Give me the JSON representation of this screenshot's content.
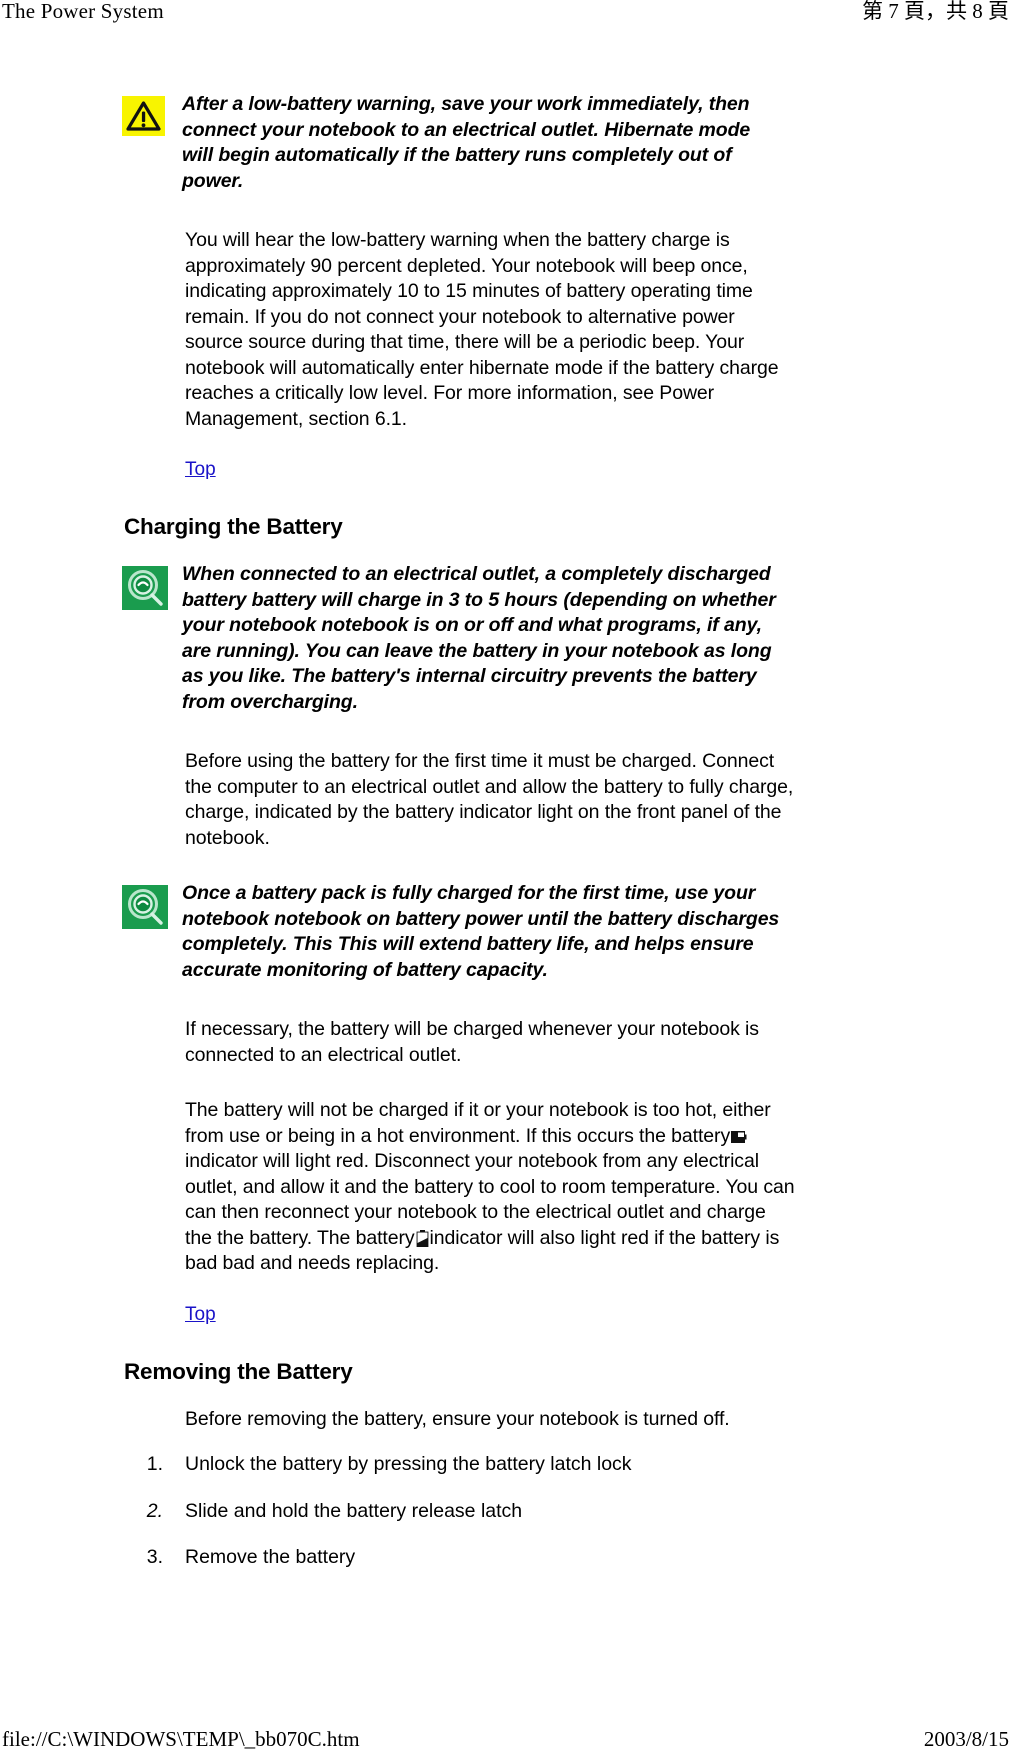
{
  "header": {
    "left_title": "The Power System",
    "right_pagination": "第 7 頁，共 8 頁"
  },
  "footer": {
    "left_path": "file://C:\\WINDOWS\\TEMP\\_bb070C.htm",
    "right_date": "2003/8/15"
  },
  "colors": {
    "warning_icon_bg": "#f8f400",
    "note_icon_bg": "#1a9c4e",
    "link": "#1a13c8",
    "text": "#000000",
    "page_bg": "#ffffff"
  },
  "content": {
    "warning_note": {
      "icon": "warning-triangle-icon",
      "text": "After a low-battery warning, save your work immediately, then connect your notebook to an electrical outlet. Hibernate mode will begin automatically if the battery runs completely out of power."
    },
    "para_low_battery": "You will hear the low-battery warning when the battery charge is approximately 90 percent depleted. Your notebook will beep once, indicating approximately 10 to 15 minutes of battery operating time remain. If you do not connect your notebook to alternative power source source during that time, there will be a periodic beep. Your notebook will automatically enter hibernate mode if the battery charge reaches a critically low level. For more information, see Power Management, section 6.1.",
    "top_link_1": "Top",
    "heading_charging": "Charging the Battery",
    "note_charging": {
      "icon": "magnifier-note-icon",
      "text": "When connected to an electrical outlet, a completely discharged battery battery will charge in 3 to 5 hours (depending on whether your notebook notebook is on or off and what programs, if any, are running). You can leave the battery in your notebook as long as you like. The battery's internal circuitry prevents the battery from overcharging."
    },
    "para_before_first_use": "Before using the battery for the first time it must be charged. Connect the computer to an electrical outlet and allow the battery to fully charge, charge, indicated by the battery indicator light on the front panel of the notebook.",
    "note_first_charge": {
      "icon": "magnifier-note-icon",
      "text": "Once a battery pack is fully charged for the first time, use your notebook notebook on battery power until the battery discharges completely. This This will extend battery life, and helps ensure accurate monitoring of battery capacity."
    },
    "para_if_necessary": "If necessary, the battery will be charged whenever your notebook is connected to an electrical outlet.",
    "para_too_hot": {
      "part1": "The battery will not be charged if it or your notebook is too hot, either from use or being in a hot environment. If this occurs the battery",
      "icon1": "battery-indicator-horizontal-icon",
      "part2": "indicator will light red. Disconnect your notebook from any electrical outlet, and allow it and the battery to cool to room temperature. You can can then reconnect your notebook to the electrical outlet and charge the the battery. The battery",
      "icon2": "battery-indicator-vertical-icon",
      "part3": "indicator will also light red if the battery is bad bad and needs replacing."
    },
    "top_link_2": "Top",
    "heading_removing": "Removing the Battery",
    "para_before_removing": "Before removing the battery, ensure your notebook is turned off.",
    "steps": [
      {
        "number": "1.",
        "text": "Unlock the battery by pressing the battery latch lock",
        "italic": false
      },
      {
        "number": "2.",
        "text": "Slide and hold the battery release latch",
        "italic": true
      },
      {
        "number": "3.",
        "text": "Remove the battery",
        "italic": false
      }
    ]
  }
}
